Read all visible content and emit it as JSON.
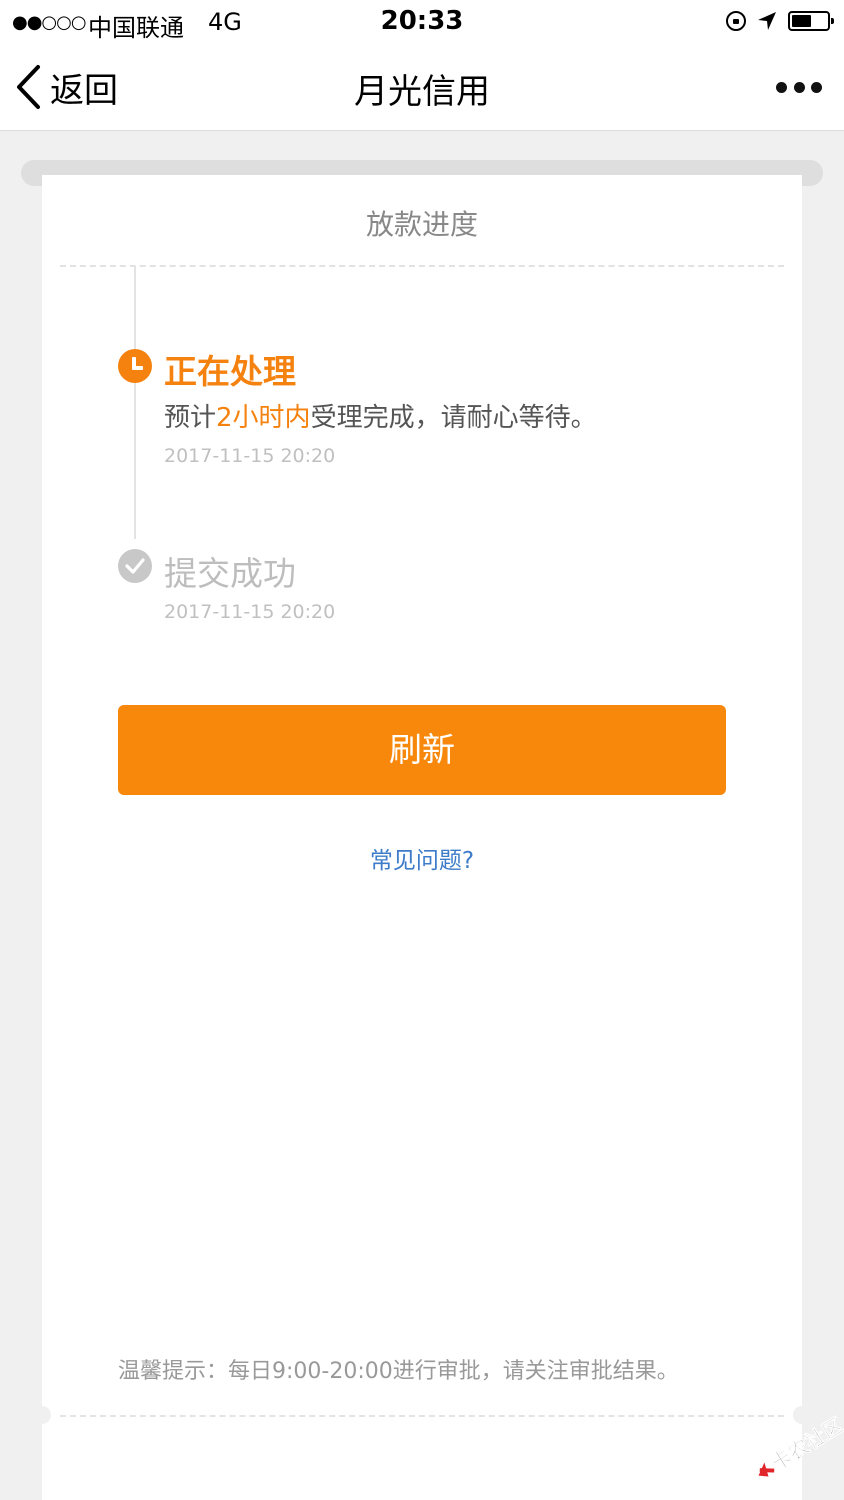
{
  "status_bar": {
    "signal": "●●○○○",
    "carrier": "中国联通",
    "network": "4G",
    "time": "20:33",
    "battery_level": 0.55
  },
  "nav": {
    "back_label": "返回",
    "title": "月光信用"
  },
  "card": {
    "title": "放款进度",
    "steps": [
      {
        "title": "正在处理",
        "desc_prefix": "预计",
        "desc_highlight": "2小时内",
        "desc_suffix": "受理完成，请耐心等待。",
        "time": "2017-11-15 20:20",
        "state": "active"
      },
      {
        "title": "提交成功",
        "time": "2017-11-15 20:20",
        "state": "done"
      }
    ],
    "refresh_label": "刷新",
    "faq_label": "常见问题?",
    "tip": "温馨提示：每日9:00-20:00进行审批，请关注审批结果。"
  },
  "colors": {
    "accent": "#f5820f",
    "link": "#3d7cc9",
    "muted": "#c0c0c0"
  },
  "watermark": {
    "text": "卡农社区"
  }
}
